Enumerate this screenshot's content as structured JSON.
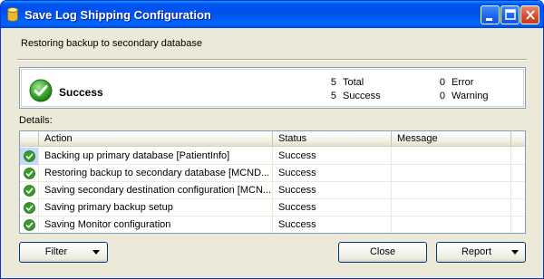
{
  "window": {
    "title": "Save Log Shipping Configuration"
  },
  "header": {
    "subtitle": "Restoring backup to secondary database"
  },
  "summary": {
    "status_label": "Success",
    "total_count": "5",
    "total_label": "Total",
    "success_count": "5",
    "success_label": "Success",
    "error_count": "0",
    "error_label": "Error",
    "warning_count": "0",
    "warning_label": "Warning"
  },
  "details": {
    "label": "Details:",
    "columns": [
      "Action",
      "Status",
      "Message"
    ],
    "rows": [
      {
        "action": "Backing up primary database [PatientInfo]",
        "status": "Success",
        "message": ""
      },
      {
        "action": "Restoring backup to secondary database [MCND...",
        "status": "Success",
        "message": ""
      },
      {
        "action": "Saving secondary destination configuration [MCN...",
        "status": "Success",
        "message": ""
      },
      {
        "action": "Saving primary backup setup",
        "status": "Success",
        "message": ""
      },
      {
        "action": "Saving Monitor configuration",
        "status": "Success",
        "message": ""
      }
    ]
  },
  "buttons": {
    "filter": "Filter",
    "close": "Close",
    "report": "Report"
  },
  "icons": {
    "status_icon": "green-check-icon",
    "app_icon": "database-icon"
  },
  "colors": {
    "titlebar": "#0054e3",
    "success_green": "#3a9b2c",
    "dialog_bg": "#ece9d8"
  }
}
